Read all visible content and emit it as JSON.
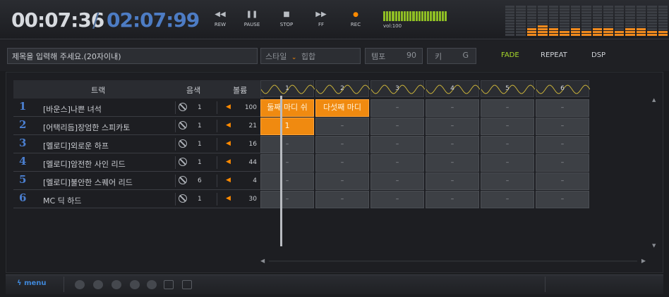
{
  "transport": {
    "time_current": "00:07:36",
    "time_separator": "/",
    "time_total": "02:07:99",
    "buttons": [
      {
        "id": "rew",
        "label": "REW",
        "icon": "rewind-icon",
        "glyph": "◀◀"
      },
      {
        "id": "pause",
        "label": "PAUSE",
        "icon": "pause-icon",
        "glyph": "❚❚"
      },
      {
        "id": "stop",
        "label": "STOP",
        "icon": "stop-icon",
        "glyph": "■"
      },
      {
        "id": "ff",
        "label": "FF",
        "icon": "fast-forward-icon",
        "glyph": "▶▶"
      },
      {
        "id": "rec",
        "label": "REC",
        "icon": "record-icon",
        "glyph": "●"
      }
    ],
    "volume_label": "vol:100",
    "volume_level": 1.0,
    "volume_color": "#8fbe24",
    "spectrum_levels": [
      0,
      0,
      3,
      4,
      3,
      2,
      3,
      2,
      3,
      3,
      2,
      3,
      3,
      2,
      2
    ],
    "spectrum_color": "#f08a1e"
  },
  "toolbar": {
    "title_placeholder": "제목을 입력해 주세요.(20자이내)",
    "style_label": "스타일",
    "style_value": "힙합",
    "tempo_label": "템포",
    "tempo_value": "90",
    "key_label": "키",
    "key_value": "G",
    "fade_label": "FADE",
    "repeat_label": "REPEAT",
    "dsp_label": "DSP",
    "accent_color": "#a6d72a"
  },
  "tracks_header": {
    "track": "트랙",
    "tone": "음색",
    "volume": "볼륨"
  },
  "tracks": [
    {
      "num": "1",
      "name": "[바운스]나쁜 녀석",
      "tone": "1",
      "volume": "100"
    },
    {
      "num": "2",
      "name": "[어택리듬]장엄한 스피카토",
      "tone": "1",
      "volume": "21"
    },
    {
      "num": "3",
      "name": "[멜로디]외로운 하프",
      "tone": "1",
      "volume": "16"
    },
    {
      "num": "4",
      "name": "[멜로디]암전한 사인 리드",
      "tone": "1",
      "volume": "44"
    },
    {
      "num": "5",
      "name": "[멜로디]불안한 스퀘어 리드",
      "tone": "6",
      "volume": "4"
    },
    {
      "num": "6",
      "name": "MC 딕 하드",
      "tone": "1",
      "volume": "30"
    }
  ],
  "bars": [
    "1",
    "2",
    "3",
    "4",
    "5",
    "6"
  ],
  "cells": [
    [
      "둘째 마디 쉬",
      "다섯째 마디",
      "–",
      "–",
      "–",
      "–"
    ],
    [
      "1",
      "–",
      "–",
      "–",
      "–",
      "–"
    ],
    [
      "–",
      "–",
      "–",
      "–",
      "–",
      "–"
    ],
    [
      "–",
      "–",
      "–",
      "–",
      "–",
      "–"
    ],
    [
      "–",
      "–",
      "–",
      "–",
      "–",
      "–"
    ],
    [
      "–",
      "–",
      "–",
      "–",
      "–",
      "–"
    ]
  ],
  "active_cells": [
    [
      0,
      0
    ],
    [
      0,
      1
    ],
    [
      1,
      0
    ]
  ],
  "playhead_position": 0.36,
  "bottom": {
    "menu_label": "menu",
    "menu_icon": "lightning-icon"
  }
}
